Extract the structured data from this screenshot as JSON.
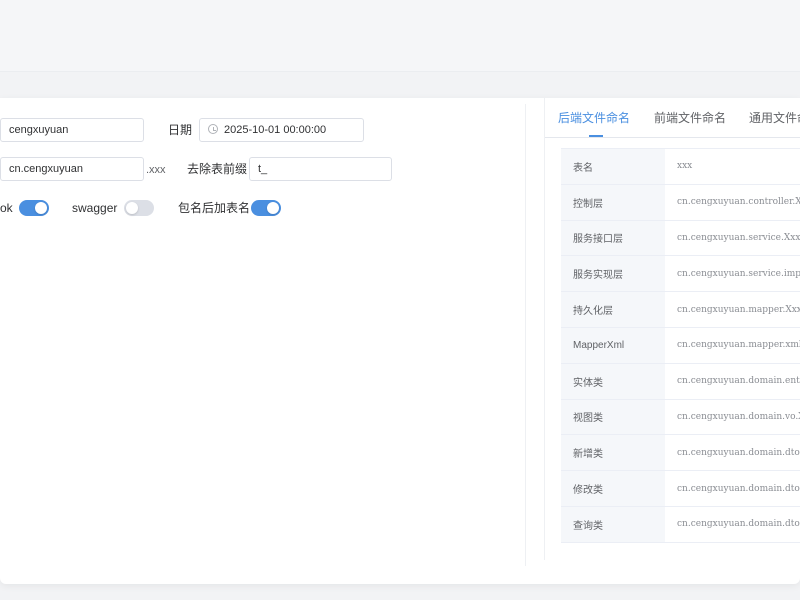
{
  "form": {
    "author_value": "cengxuyuan",
    "date_label": "日期",
    "date_value": "2025-10-01 00:00:00",
    "package_value": "cn.cengxuyuan",
    "package_suffix": ".xxx",
    "prefix_label": "去除表前缀",
    "prefix_value": "t_",
    "lombok_label": "ok",
    "lombok_on": true,
    "swagger_label": "swagger",
    "swagger_on": false,
    "pkg_table_label": "包名后加表名",
    "pkg_table_on": true
  },
  "tabs": [
    {
      "label": "后端文件命名",
      "active": true
    },
    {
      "label": "前端文件命名",
      "active": false
    },
    {
      "label": "通用文件命",
      "active": false
    }
  ],
  "naming_table": [
    {
      "key": "表名",
      "value": "xxx"
    },
    {
      "key": "控制层",
      "value": "cn.cengxuyuan.controller.X"
    },
    {
      "key": "服务接口层",
      "value": "cn.cengxuyuan.service.Xxx"
    },
    {
      "key": "服务实现层",
      "value": "cn.cengxuyuan.service.imp"
    },
    {
      "key": "持久化层",
      "value": "cn.cengxuyuan.mapper.XxxM"
    },
    {
      "key": "MapperXml",
      "value": "cn.cengxuyuan.mapper.xml."
    },
    {
      "key": "实体类",
      "value": "cn.cengxuyuan.domain.enti"
    },
    {
      "key": "视图类",
      "value": "cn.cengxuyuan.domain.vo.X"
    },
    {
      "key": "新增类",
      "value": "cn.cengxuyuan.domain.dto."
    },
    {
      "key": "修改类",
      "value": "cn.cengxuyuan.domain.dto."
    },
    {
      "key": "查询类",
      "value": "cn.cengxuyuan.domain.dto."
    }
  ],
  "colors": {
    "accent": "#4a8fe0",
    "switch_off": "#dcdfe6"
  }
}
